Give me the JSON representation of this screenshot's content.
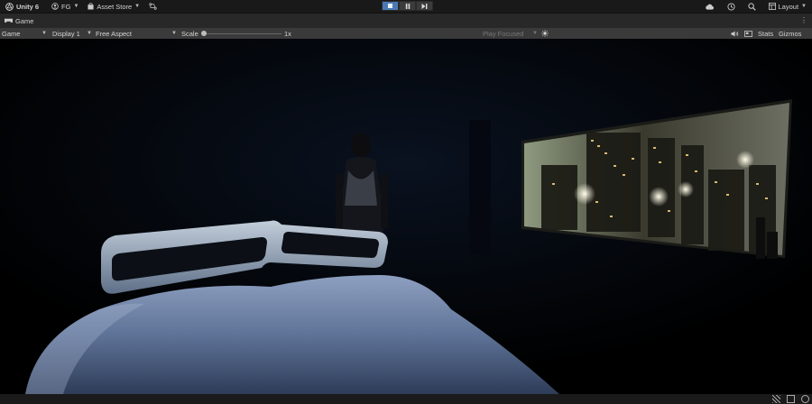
{
  "toolbar": {
    "app_name": "Unity 6",
    "account": "FG",
    "asset_store": "Asset Store",
    "layout": "Layout"
  },
  "tabs": [
    {
      "label": "Game"
    }
  ],
  "game_toolbar": {
    "mode": "Game",
    "display": "Display 1",
    "aspect": "Free Aspect",
    "scale_label": "Scale",
    "scale_value": "1x",
    "play_mode": "Play Focused",
    "stats": "Stats",
    "gizmos": "Gizmos"
  },
  "icons": {
    "unity": "unity-logo-icon",
    "account": "account-icon",
    "store": "store-bag-icon",
    "version_control": "branch-icon",
    "stop": "stop-icon",
    "pause": "pause-icon",
    "step": "step-icon",
    "cloud": "cloud-icon",
    "history": "history-icon",
    "search": "search-icon",
    "layout": "layout-icon",
    "game_tab": "game-controller-icon",
    "kebab": "kebab-menu-icon",
    "sun": "sun-icon",
    "mute": "audio-icon",
    "stats_overlay": "stats-icon"
  },
  "colors": {
    "play_active": "#4a78b4",
    "toolbar_bg": "#191919",
    "panel_bg": "#282828",
    "gamebar_bg": "#3a3a3a"
  }
}
